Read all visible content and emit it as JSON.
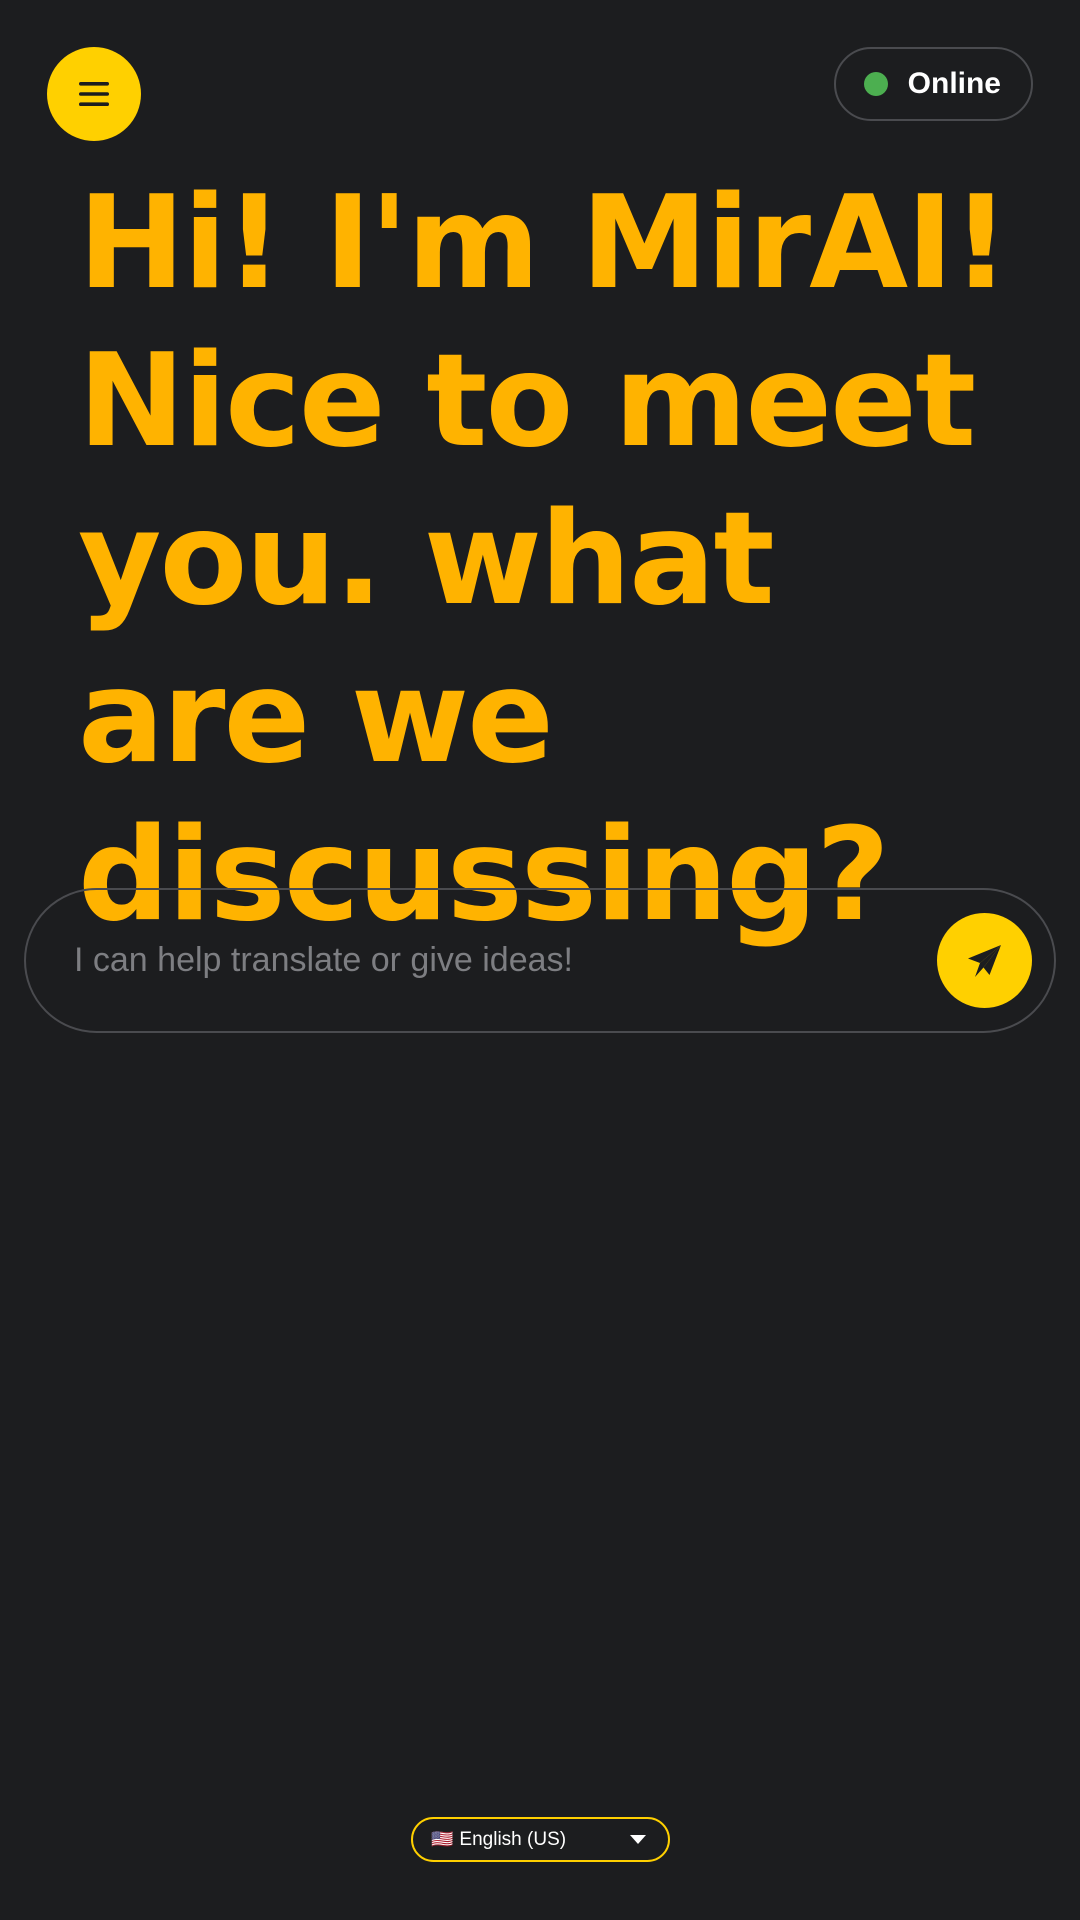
{
  "header": {
    "menu_icon": "hamburger-menu-icon",
    "status": {
      "label": "Online",
      "dot_color": "#4caf50"
    }
  },
  "main": {
    "headline": "Hi! I'm MirAI! Nice to meet you. what are we discussing?",
    "composer": {
      "placeholder": "I can help translate or give ideas!",
      "value": "",
      "send_icon": "paper-plane-icon"
    }
  },
  "footer": {
    "language": {
      "flag": "🇺🇸",
      "selected": "English (US)",
      "caret_icon": "caret-down-icon"
    }
  },
  "colors": {
    "accent": "#ffd000",
    "headline": "#ffb300",
    "background": "#1c1d1f"
  }
}
